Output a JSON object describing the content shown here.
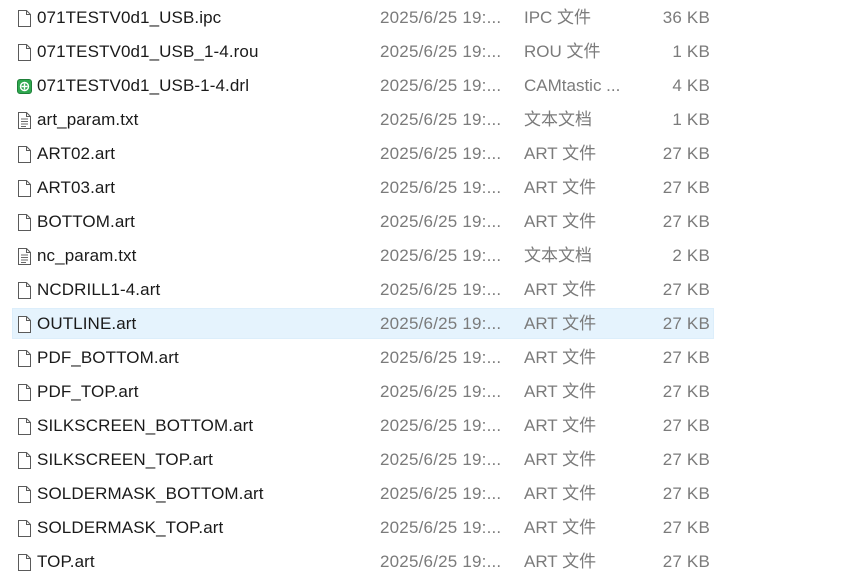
{
  "files": [
    {
      "name": "071TESTV0d1_USB.ipc",
      "date": "2025/6/25 19:...",
      "type": "IPC 文件",
      "size": "36 KB",
      "icon": "blank-file-icon",
      "selected": false
    },
    {
      "name": "071TESTV0d1_USB_1-4.rou",
      "date": "2025/6/25 19:...",
      "type": "ROU 文件",
      "size": "1 KB",
      "icon": "blank-file-icon",
      "selected": false
    },
    {
      "name": "071TESTV0d1_USB-1-4.drl",
      "date": "2025/6/25 19:...",
      "type": "CAMtastic ...",
      "size": "4 KB",
      "icon": "camtastic-file-icon",
      "selected": false
    },
    {
      "name": "art_param.txt",
      "date": "2025/6/25 19:...",
      "type": "文本文档",
      "size": "1 KB",
      "icon": "text-file-icon",
      "selected": false
    },
    {
      "name": "ART02.art",
      "date": "2025/6/25 19:...",
      "type": "ART 文件",
      "size": "27 KB",
      "icon": "blank-file-icon",
      "selected": false
    },
    {
      "name": "ART03.art",
      "date": "2025/6/25 19:...",
      "type": "ART 文件",
      "size": "27 KB",
      "icon": "blank-file-icon",
      "selected": false
    },
    {
      "name": "BOTTOM.art",
      "date": "2025/6/25 19:...",
      "type": "ART 文件",
      "size": "27 KB",
      "icon": "blank-file-icon",
      "selected": false
    },
    {
      "name": "nc_param.txt",
      "date": "2025/6/25 19:...",
      "type": "文本文档",
      "size": "2 KB",
      "icon": "text-file-icon",
      "selected": false
    },
    {
      "name": "NCDRILL1-4.art",
      "date": "2025/6/25 19:...",
      "type": "ART 文件",
      "size": "27 KB",
      "icon": "blank-file-icon",
      "selected": false
    },
    {
      "name": "OUTLINE.art",
      "date": "2025/6/25 19:...",
      "type": "ART 文件",
      "size": "27 KB",
      "icon": "blank-file-icon",
      "selected": true
    },
    {
      "name": "PDF_BOTTOM.art",
      "date": "2025/6/25 19:...",
      "type": "ART 文件",
      "size": "27 KB",
      "icon": "blank-file-icon",
      "selected": false
    },
    {
      "name": "PDF_TOP.art",
      "date": "2025/6/25 19:...",
      "type": "ART 文件",
      "size": "27 KB",
      "icon": "blank-file-icon",
      "selected": false
    },
    {
      "name": "SILKSCREEN_BOTTOM.art",
      "date": "2025/6/25 19:...",
      "type": "ART 文件",
      "size": "27 KB",
      "icon": "blank-file-icon",
      "selected": false
    },
    {
      "name": "SILKSCREEN_TOP.art",
      "date": "2025/6/25 19:...",
      "type": "ART 文件",
      "size": "27 KB",
      "icon": "blank-file-icon",
      "selected": false
    },
    {
      "name": "SOLDERMASK_BOTTOM.art",
      "date": "2025/6/25 19:...",
      "type": "ART 文件",
      "size": "27 KB",
      "icon": "blank-file-icon",
      "selected": false
    },
    {
      "name": "SOLDERMASK_TOP.art",
      "date": "2025/6/25 19:...",
      "type": "ART 文件",
      "size": "27 KB",
      "icon": "blank-file-icon",
      "selected": false
    },
    {
      "name": "TOP.art",
      "date": "2025/6/25 19:...",
      "type": "ART 文件",
      "size": "27 KB",
      "icon": "blank-file-icon",
      "selected": false
    }
  ],
  "colors": {
    "name_text": "#1a1a1a",
    "detail_text": "#7b7b7b",
    "selection_fill": "#e5f3fd",
    "camtastic_icon": "#2fa84f"
  }
}
